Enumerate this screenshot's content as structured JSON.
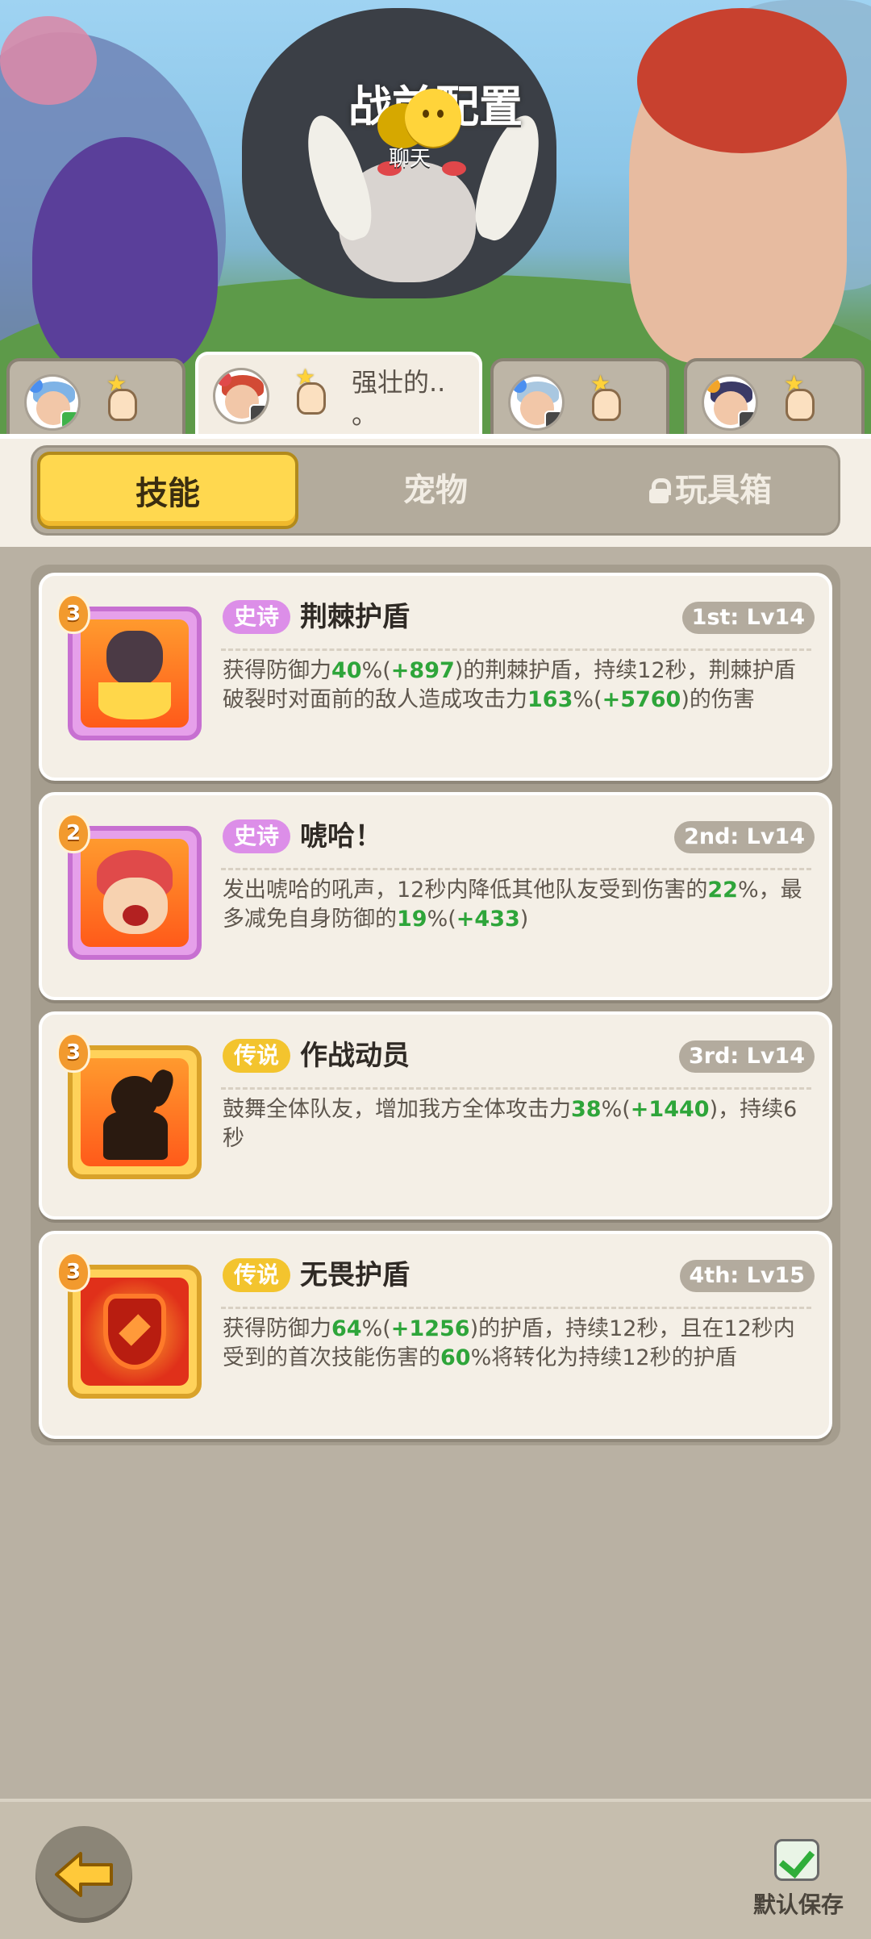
{
  "header": {
    "title": "战前配置",
    "chat_label": "聊天"
  },
  "hero_tabs": [
    {
      "name": "",
      "active": false
    },
    {
      "name_line1": "强壮的..",
      "name_line2": "。",
      "active": true
    },
    {
      "name": "",
      "active": false
    },
    {
      "name": "",
      "active": false
    }
  ],
  "categories": {
    "skills": "技能",
    "pets": "宠物",
    "toybox": "玩具箱",
    "active": "skills"
  },
  "skills": [
    {
      "level": "3",
      "rarity": "史诗",
      "rarity_type": "epic",
      "name": "荆棘护盾",
      "slot": "1st: Lv14",
      "desc": [
        {
          "t": "获得防御力"
        },
        {
          "t": "40",
          "g": true
        },
        {
          "t": "%("
        },
        {
          "t": "+897",
          "g": true
        },
        {
          "t": ")的荆棘护盾，持续12秒，荆棘护盾破裂时对面前的敌人造成攻击力"
        },
        {
          "t": "163",
          "g": true
        },
        {
          "t": "%("
        },
        {
          "t": "+5760",
          "g": true
        },
        {
          "t": ")的伤害"
        }
      ]
    },
    {
      "level": "2",
      "rarity": "史诗",
      "rarity_type": "epic",
      "name": "唬哈！",
      "slot": "2nd: Lv14",
      "desc": [
        {
          "t": "发出唬哈的吼声，12秒内降低其他队友受到伤害的"
        },
        {
          "t": "22",
          "g": true
        },
        {
          "t": "%，最多减免自身防御的"
        },
        {
          "t": "19",
          "g": true
        },
        {
          "t": "%("
        },
        {
          "t": "+433",
          "g": true
        },
        {
          "t": ")"
        }
      ]
    },
    {
      "level": "3",
      "rarity": "传说",
      "rarity_type": "legend",
      "name": "作战动员",
      "slot": "3rd: Lv14",
      "desc": [
        {
          "t": "鼓舞全体队友，增加我方全体攻击力"
        },
        {
          "t": "38",
          "g": true
        },
        {
          "t": "%("
        },
        {
          "t": "+1440",
          "g": true
        },
        {
          "t": ")，持续6秒"
        }
      ]
    },
    {
      "level": "3",
      "rarity": "传说",
      "rarity_type": "legend",
      "name": "无畏护盾",
      "slot": "4th: Lv15",
      "desc": [
        {
          "t": "获得防御力"
        },
        {
          "t": "64",
          "g": true
        },
        {
          "t": "%("
        },
        {
          "t": "+1256",
          "g": true
        },
        {
          "t": ")的护盾，持续12秒，且在12秒内受到的首次技能伤害的"
        },
        {
          "t": "60",
          "g": true
        },
        {
          "t": "%将转化为持续12秒的护盾"
        }
      ]
    }
  ],
  "footer": {
    "save_label": "默认保存",
    "save_checked": true
  },
  "colors": {
    "highlight_number": "#2ea53a",
    "active_tab": "#ffd84f",
    "epic": "#dc8ee8",
    "legend": "#f3c42e"
  },
  "icons": [
    "chat-icon",
    "tap-hand-icon",
    "lock-icon",
    "back-arrow-icon",
    "checkbox-icon"
  ]
}
